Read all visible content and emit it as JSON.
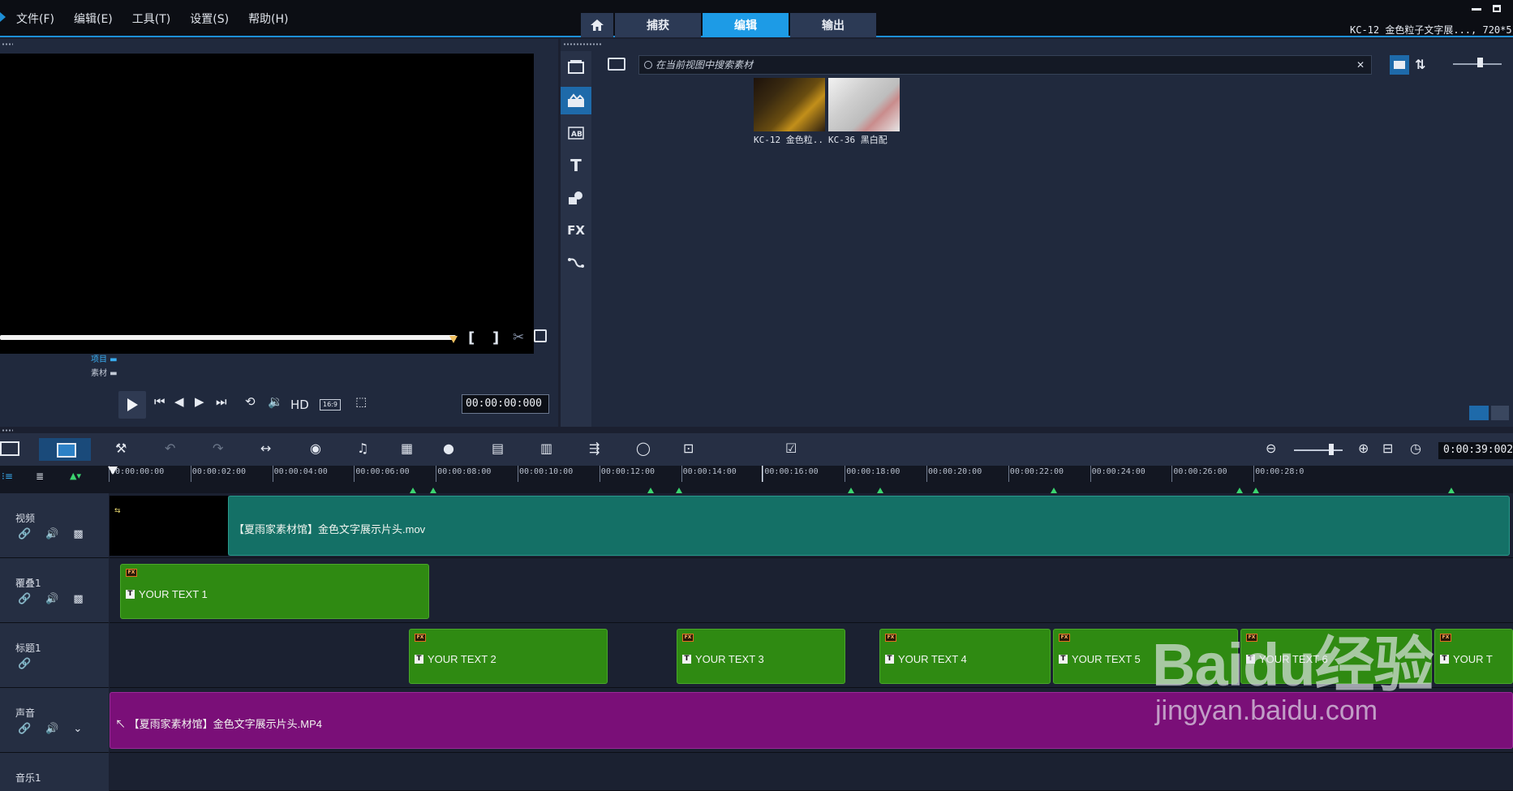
{
  "menu": [
    "文件(F)",
    "编辑(E)",
    "工具(T)",
    "设置(S)",
    "帮助(H)"
  ],
  "tabs": {
    "capture": "捕获",
    "edit": "编辑",
    "share": "输出"
  },
  "project_info": "KC-12 金色粒子文字展..., 720*5",
  "preview": {
    "mode_project": "项目",
    "mode_clip": "素材",
    "hd": "HD",
    "aspect": "16:9",
    "timecode": "00:00:00:000"
  },
  "library": {
    "search_placeholder": "在当前视图中搜索素材",
    "items": [
      {
        "label": "KC-12 金色粒..."
      },
      {
        "label": "KC-36 黑白配"
      }
    ],
    "tools": [
      "media-icon",
      "transition-icon",
      "title-icon",
      "graphics-icon",
      "fx-icon",
      "path-icon"
    ],
    "fx_label": "FX"
  },
  "timeline": {
    "duration": "0:00:39:002",
    "ruler": [
      "00:00:00:00",
      "00:00:02:00",
      "00:00:04:00",
      "00:00:06:00",
      "00:00:08:00",
      "00:00:10:00",
      "00:00:12:00",
      "00:00:14:00",
      "00:00:16:00",
      "00:00:18:00",
      "00:00:20:00",
      "00:00:22:00",
      "00:00:24:00",
      "00:00:26:00",
      "00:00:28:0"
    ],
    "tracks": [
      {
        "name": "视频"
      },
      {
        "name": "覆叠1"
      },
      {
        "name": "标题1"
      },
      {
        "name": "声音"
      },
      {
        "name": "音乐1"
      }
    ],
    "video_clip": "【夏雨家素材馆】金色文字展示片头.mov",
    "overlay_clip": "YOUR TEXT 1",
    "title_clips": [
      "YOUR TEXT 2",
      "YOUR TEXT 3",
      "YOUR TEXT 4",
      "YOUR TEXT 5",
      "YOUR TEXT 6",
      "YOUR T"
    ],
    "audio_clip": "【夏雨家素材馆】金色文字展示片头.MP4"
  },
  "watermark": {
    "brand": "Baidu经验",
    "url": "jingyan.baidu.com"
  },
  "colors": {
    "accent": "#1d9be6",
    "clip_green": "#2f8a12",
    "clip_teal": "#147066",
    "clip_purple": "#7a0f78"
  }
}
